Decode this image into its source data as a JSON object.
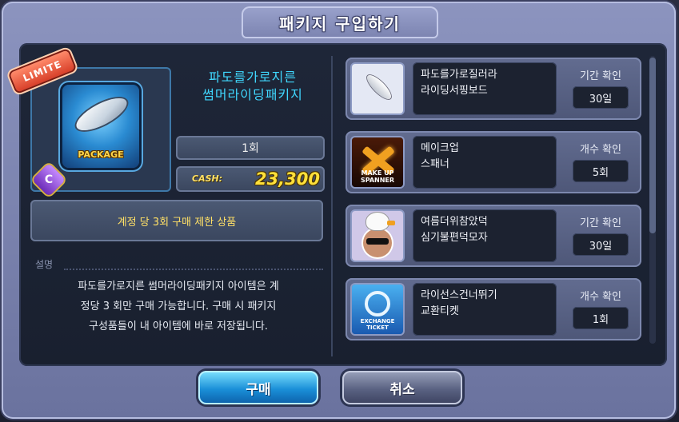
{
  "dialog": {
    "title": "패키지 구입하기"
  },
  "product": {
    "badge": "LIMITE",
    "package_label": "PACKAGE",
    "c_badge": "C",
    "name_line1": "파도를가로지른",
    "name_line2": "썸머라이딩패키지",
    "quantity": "1회",
    "cash_label": "CASH:",
    "price": "23,300",
    "limit_notice": "계정 당 3회 구매 제한 상품"
  },
  "description": {
    "header": "설명",
    "line1": "파도를가로지른 썸머라이딩패키지 아이템은 계",
    "line2": "정당 3 회만 구매 가능합니다. 구매 시 패키지",
    "line3": "구성품들이 내 아이템에 바로 저장됩니다."
  },
  "items": [
    {
      "name_line1": "파도를가로질러라",
      "name_line2": "라이딩서핑보드",
      "label": "기간 확인",
      "value": "30일",
      "icon": "surfboard-icon"
    },
    {
      "name_line1": "메이크업",
      "name_line2": "스패너",
      "label": "개수 확인",
      "value": "5회",
      "icon": "spanner-icon",
      "icon_text": "MAKE UP SPANNER"
    },
    {
      "name_line1": "여름더위참았덕",
      "name_line2": "심기불편덕모자",
      "label": "기간 확인",
      "value": "30일",
      "icon": "duck-hat-icon"
    },
    {
      "name_line1": "라이선스건너뛰기",
      "name_line2": "교환티켓",
      "label": "개수 확인",
      "value": "1회",
      "icon": "exchange-ticket-icon",
      "icon_text": "EXCHANGE TICKET"
    }
  ],
  "buttons": {
    "buy": "구매",
    "cancel": "취소"
  },
  "colors": {
    "name_accent": "#40d8ff",
    "price": "#ffe03a",
    "notice": "#ffe066"
  }
}
